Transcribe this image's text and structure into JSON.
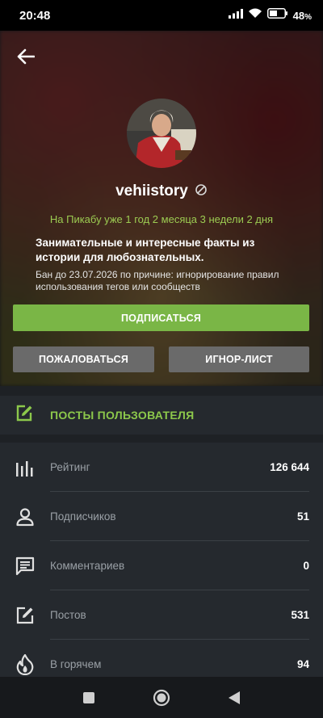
{
  "status_bar": {
    "time": "20:48",
    "battery_percent": "48",
    "battery_percent_suffix": "%"
  },
  "profile": {
    "username": "vehiistory",
    "member_since": "На Пикабу уже 1 год 2 месяца 3 недели 2 дня",
    "about": "Занимательные и интересные факты из истории для любознательных.",
    "ban_notice": "Бан до 23.07.2026 по причине: игнорирование правил использования тегов или сообществ"
  },
  "buttons": {
    "subscribe": "ПОДПИСАТЬСЯ",
    "report": "ПОЖАЛОВАТЬСЯ",
    "ignore": "ИГНОР-ЛИСТ"
  },
  "posts_section": {
    "label": "ПОСТЫ ПОЛЬЗОВАТЕЛЯ"
  },
  "stats": [
    {
      "label": "Рейтинг",
      "value": "126 644",
      "icon": "rating-bars-icon"
    },
    {
      "label": "Подписчиков",
      "value": "51",
      "icon": "person-icon"
    },
    {
      "label": "Комментариев",
      "value": "0",
      "icon": "comment-icon"
    },
    {
      "label": "Постов",
      "value": "531",
      "icon": "edit-post-icon"
    },
    {
      "label": "В горячем",
      "value": "94",
      "icon": "fire-icon"
    }
  ],
  "colors": {
    "accent_green": "#7ab646",
    "secondary_button": "#6a6a6a",
    "surface": "#25292e",
    "background": "#1e2125"
  }
}
